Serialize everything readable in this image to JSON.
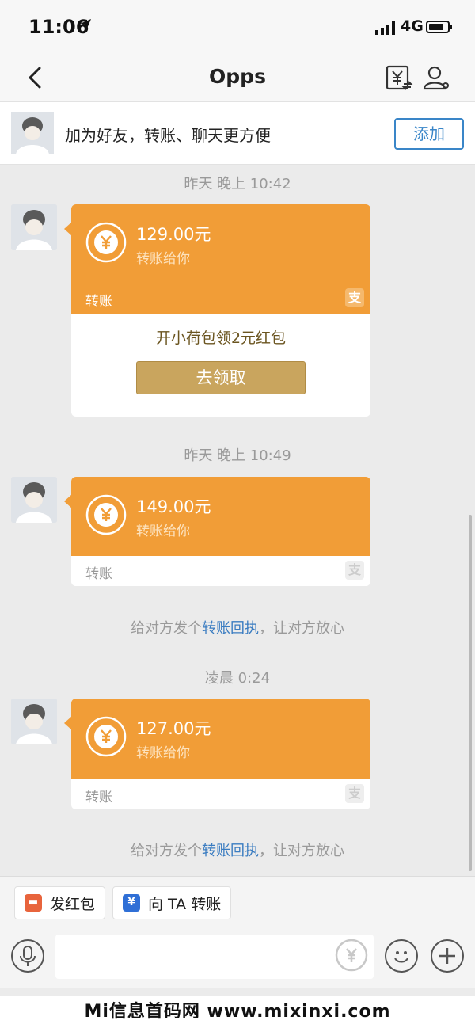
{
  "status": {
    "time": "11:06",
    "network": "4G"
  },
  "nav": {
    "title": "Opps"
  },
  "banner": {
    "text": "加为好友，转账、聊天更方便",
    "add_label": "添加"
  },
  "messages": [
    {
      "time": "昨天 晚上 10:42",
      "amount": "129.00元",
      "sub": "转账给你",
      "footer": "转账",
      "zhi": "支",
      "promo": "开小荷包领2元红包",
      "promo_button": "去领取"
    },
    {
      "time": "昨天 晚上 10:49",
      "amount": "149.00元",
      "sub": "转账给你",
      "footer": "转账",
      "zhi": "支",
      "receipt_before": "给对方发个",
      "receipt_link": "转账回执",
      "receipt_after": "，让对方放心"
    },
    {
      "time": "凌晨 0:24",
      "amount": "127.00元",
      "sub": "转账给你",
      "footer": "转账",
      "zhi": "支",
      "receipt_before": "给对方发个",
      "receipt_link": "转账回执",
      "receipt_after": "，让对方放心"
    }
  ],
  "quick_actions": [
    {
      "label": "发红包",
      "icon": "red-envelope-icon",
      "color": "#e8643c"
    },
    {
      "label": "向 TA 转账",
      "icon": "transfer-icon",
      "color": "#2f6fd6"
    }
  ],
  "watermark": "Mi信息首码网 www.mixinxi.com",
  "colors": {
    "accent": "#f19d37",
    "link": "#3a7cc1",
    "gold": "#c9a55e"
  }
}
